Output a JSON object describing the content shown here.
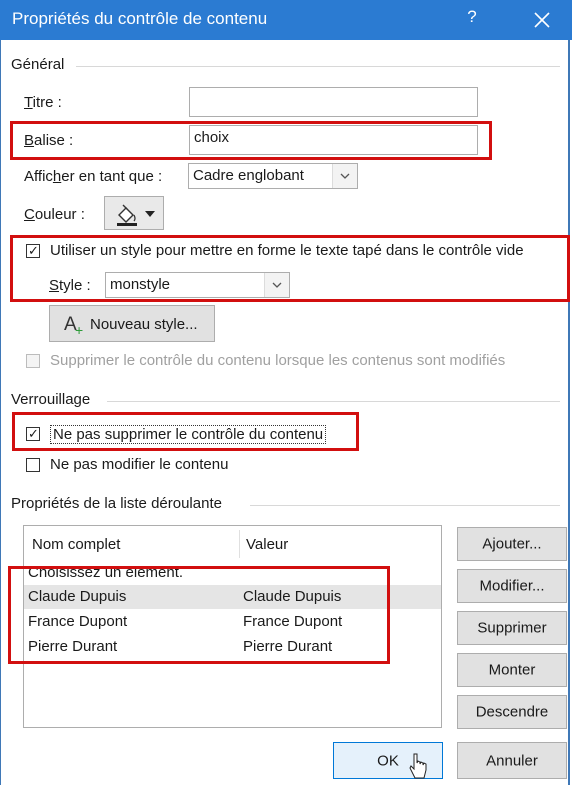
{
  "window": {
    "title": "Propriétés du contrôle de contenu",
    "help_label": "?"
  },
  "general": {
    "section_title": "Général",
    "titre_label": "Titre :",
    "titre_value": "",
    "balise_label": "Balise :",
    "balise_value": "choix",
    "afficher_label": "Afficher en tant que :",
    "afficher_value": "Cadre englobant",
    "couleur_label": "Couleur :",
    "use_style_label": "Utiliser un style pour mettre en forme le texte tapé dans le contrôle vide",
    "use_style_checked": true,
    "style_label": "Style :",
    "style_value": "monstyle",
    "new_style_label": "Nouveau style...",
    "remove_when_edited_label": "Supprimer le contrôle du contenu lorsque les contenus sont modifiés",
    "remove_when_edited_checked": false
  },
  "locking": {
    "section_title": "Verrouillage",
    "no_delete_label": "Ne pas supprimer le contrôle du contenu",
    "no_delete_checked": true,
    "no_edit_label": "Ne pas modifier le contenu",
    "no_edit_checked": false
  },
  "dropdown": {
    "section_title": "Propriétés de la liste déroulante",
    "columns": [
      "Nom complet",
      "Valeur"
    ],
    "rows": [
      {
        "name": "Choisissez un élément.",
        "value": ""
      },
      {
        "name": "Claude Dupuis",
        "value": "Claude Dupuis"
      },
      {
        "name": "France Dupont",
        "value": "France Dupont"
      },
      {
        "name": "Pierre Durant",
        "value": "Pierre Durant"
      }
    ],
    "selected_row": 1,
    "buttons": {
      "add": "Ajouter...",
      "modify": "Modifier...",
      "delete": "Supprimer",
      "up": "Monter",
      "down": "Descendre"
    }
  },
  "footer": {
    "ok": "OK",
    "cancel": "Annuler"
  },
  "colors": {
    "titlebar": "#2b7bd2",
    "highlight": "#d20f0f",
    "selected_row": "#e5e5e5"
  }
}
